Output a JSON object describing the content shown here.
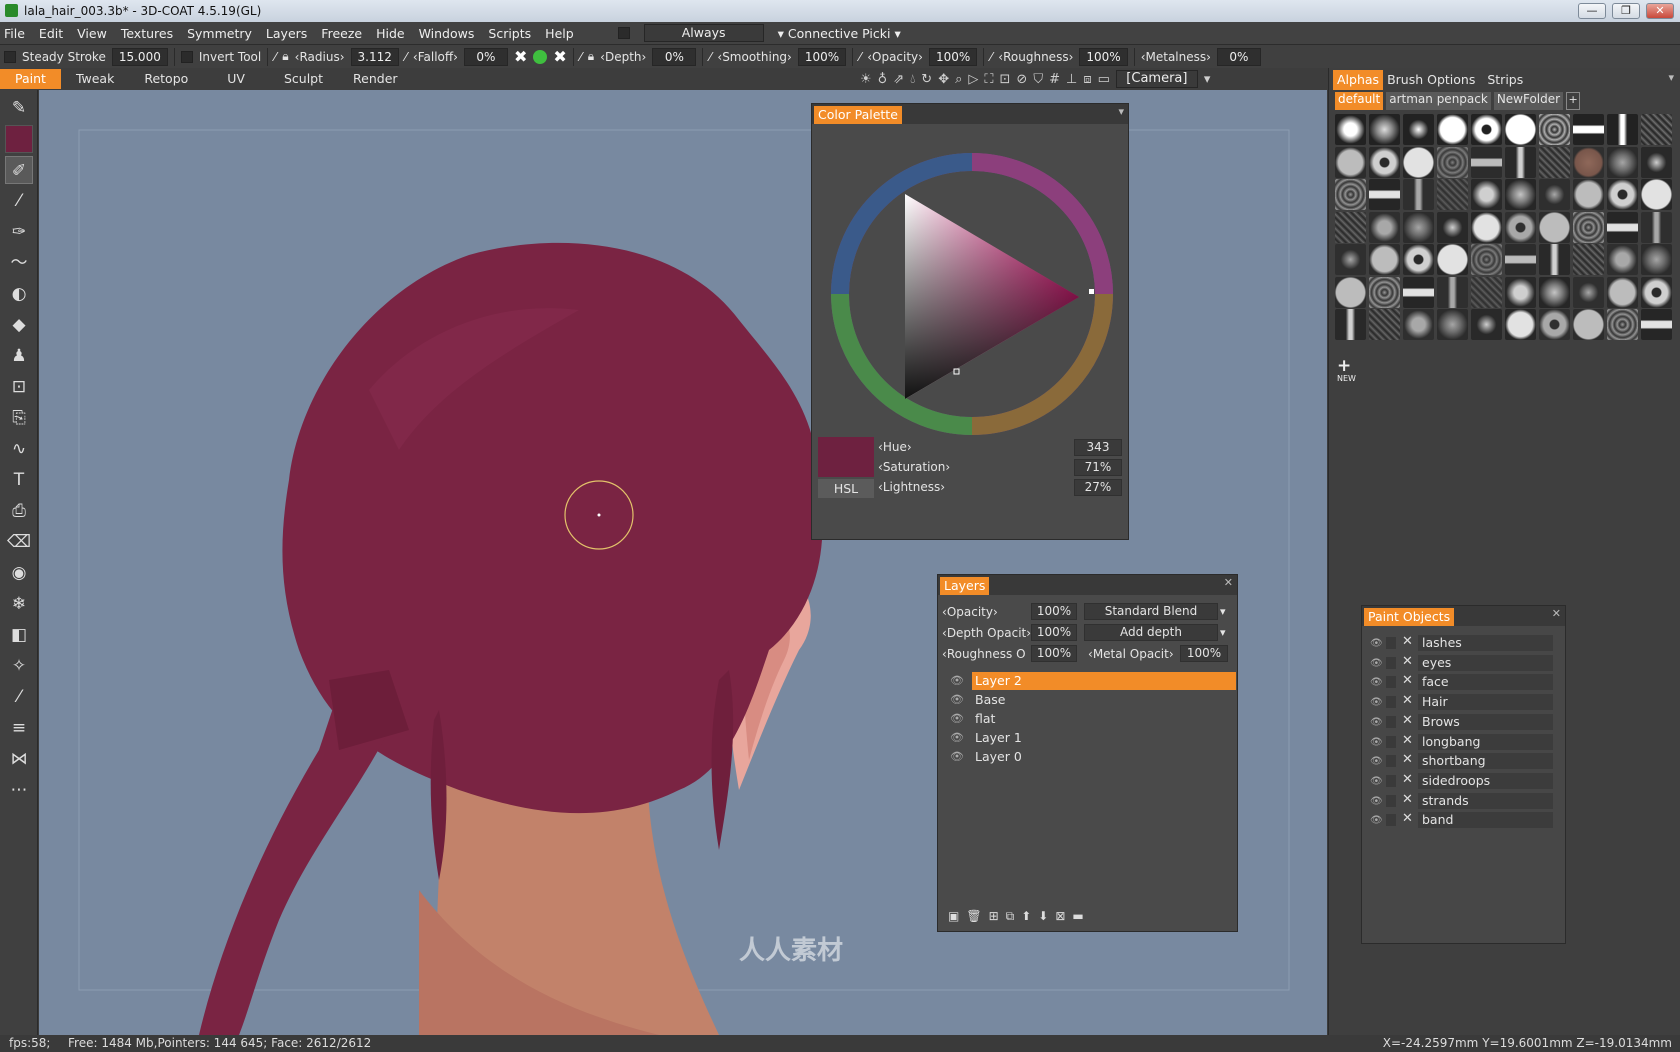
{
  "window": {
    "title": "lala_hair_003.3b* - 3D-COAT 4.5.19(GL)",
    "controls": [
      "—",
      "❐",
      "✕"
    ]
  },
  "menu": [
    "File",
    "Edit",
    "View",
    "Textures",
    "Symmetry",
    "Layers",
    "Freeze",
    "Hide",
    "Windows",
    "Scripts",
    "Help"
  ],
  "menu_right": {
    "always_label": "Always",
    "pick_label": "Connective Picki"
  },
  "options": {
    "steady_stroke_label": "Steady  Stroke",
    "steady_stroke_value": "15.000",
    "invert_tool_label": "Invert  Tool",
    "radius_label": "Radius",
    "radius_value": "3.112",
    "falloff_label": "Falloff",
    "falloff_value": "0%",
    "depth_label": "Depth",
    "depth_value": "0%",
    "smoothing_label": "Smoothing",
    "smoothing_value": "100%",
    "opacity_label": "Opacity",
    "opacity_value": "100%",
    "roughness_label": "Roughness",
    "roughness_value": "100%",
    "metalness_label": "Metalness",
    "metalness_value": "0%"
  },
  "rooms": [
    "Paint",
    "Tweak",
    "Retopo",
    "UV",
    "Sculpt",
    "Render"
  ],
  "active_room": "Paint",
  "camera_label": "[Camera]",
  "right_tabs": [
    "Alphas",
    "Brush  Options",
    "Strips"
  ],
  "alpha_folders": [
    "default",
    "artman  penpack",
    "NewFolder"
  ],
  "new_label": "NEW",
  "color_palette": {
    "title": "Color  Palette",
    "swatch_color": "#6e2140",
    "mode": "HSL",
    "hue_label": "Hue",
    "hue_value": "343",
    "saturation_label": "Saturation",
    "saturation_value": "71%",
    "lightness_label": "Lightness",
    "lightness_value": "27%"
  },
  "layers_panel": {
    "title": "Layers",
    "opacity_label": "Opacity",
    "opacity_value": "100%",
    "blend_mode": "Standard  Blend",
    "depth_opacity_label": "Depth  Opacit",
    "depth_opacity_value": "100%",
    "depth_mode": "Add  depth",
    "roughness_label": "Roughness  O",
    "roughness_value": "100%",
    "metal_label": "Metal  Opacit",
    "metal_value": "100%",
    "layers": [
      "Layer  2",
      "Base",
      "flat",
      "Layer  1",
      "Layer  0"
    ],
    "active_layer": "Layer  2"
  },
  "paint_objects": {
    "title": "Paint  Objects",
    "objects": [
      "lashes",
      "eyes",
      "face",
      "Hair",
      "Brows",
      "longbang",
      "shortbang",
      "sidedroops",
      "strands",
      "band"
    ]
  },
  "status": {
    "fps": "fps:58;",
    "info": "Free:  1484  Mb,Pointers:  144  645;  Face:  2612/2612",
    "coords": "X=-24.2597mm  Y=19.6001mm  Z=-19.0134mm"
  },
  "watermark": "人人素材",
  "colors": {
    "accent": "#f28c28",
    "hair": "#7a2443",
    "skin": "#c8826a",
    "viewport": "#7889a0"
  },
  "tool_icons": [
    "paint-brush-icon",
    "color-swatch-icon",
    "brush-icon",
    "pen-icon",
    "airbrush-icon",
    "smudge-icon",
    "blur-icon",
    "fill-icon",
    "stamp-icon",
    "transform-icon",
    "copy-icon",
    "curve-icon",
    "text-icon",
    "clone-icon",
    "eraser-icon",
    "eye-icon",
    "freeze-icon",
    "ruler-icon",
    "wand-icon",
    "picker-icon",
    "iron-icon",
    "symmetry-icon",
    "measure-icon"
  ]
}
